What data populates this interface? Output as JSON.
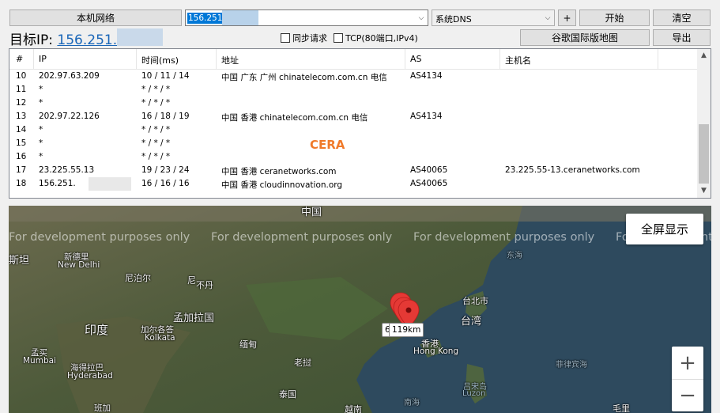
{
  "toolbar": {
    "local_network_label": "本机网络",
    "target_input_value": "156.251.",
    "dns_select_value": "系统DNS",
    "add_label": "+",
    "start_label": "开始",
    "clear_label": "清空",
    "google_map_label": "谷歌国际版地图",
    "export_label": "导出"
  },
  "target": {
    "label": "目标IP:",
    "ip": "156.251."
  },
  "options": {
    "sync_request": "同步请求",
    "tcp_option": "TCP(80端口,IPv4)"
  },
  "table": {
    "columns": [
      "#",
      "IP",
      "时间(ms)",
      "地址",
      "AS",
      "主机名"
    ],
    "rows": [
      {
        "hop": "10",
        "ip": "202.97.63.209",
        "time": "10 / 11 / 14",
        "addr": "中国 广东 广州 chinatelecom.com.cn 电信",
        "as": "AS4134",
        "host": ""
      },
      {
        "hop": "11",
        "ip": "*",
        "time": "* / * / *",
        "addr": "",
        "as": "",
        "host": ""
      },
      {
        "hop": "12",
        "ip": "*",
        "time": "* / * / *",
        "addr": "",
        "as": "",
        "host": ""
      },
      {
        "hop": "13",
        "ip": "202.97.22.126",
        "time": "16 / 18 / 19",
        "addr": "中国 香港 chinatelecom.com.cn 电信",
        "as": "AS4134",
        "host": ""
      },
      {
        "hop": "14",
        "ip": "*",
        "time": "* / * / *",
        "addr": "",
        "as": "",
        "host": ""
      },
      {
        "hop": "15",
        "ip": "*",
        "time": "* / * / *",
        "addr": "",
        "as": "",
        "host": ""
      },
      {
        "hop": "16",
        "ip": "*",
        "time": "* / * / *",
        "addr": "",
        "as": "",
        "host": ""
      },
      {
        "hop": "17",
        "ip": "23.225.55.13",
        "time": "19 / 23 / 24",
        "addr": "中国 香港 ceranetworks.com",
        "as": "AS40065",
        "host": "23.225.55-13.ceranetworks.com"
      },
      {
        "hop": "18",
        "ip": "156.251.",
        "time": "16 / 16 / 16",
        "addr": "中国 香港 cloudinnovation.org",
        "as": "AS40065",
        "host": ""
      }
    ],
    "overlay_label": "CERA"
  },
  "map": {
    "watermark": "For development purposes only",
    "fullscreen_label": "全屏显示",
    "zoom_in": "+",
    "zoom_out": "−",
    "distance_label": "119km",
    "labels": {
      "china": "中国",
      "delhi_cn": "新德里",
      "delhi_en": "New Delhi",
      "india": "印度",
      "nepal": "尼泊尔",
      "bangladesh": "孟加拉国",
      "kolkata_cn": "加尔各答",
      "kolkata_en": "Kolkata",
      "myanmar": "缅甸",
      "laos": "老挝",
      "thailand": "泰国",
      "vietnam": "越南",
      "taipei": "台北市",
      "taiwan": "台湾",
      "hongkong_cn": "香港",
      "hongkong_en": "Hong Kong",
      "mumbai_cn": "孟买",
      "mumbai_en": "Mumbai",
      "hyderabad_cn": "海得拉巴",
      "hyderabad_en": "Hyderabad",
      "pakistan_short": "斯坦",
      "east_sea": "东海",
      "philippine_sea": "菲律宾海",
      "luzon_cn": "吕宋岛",
      "luzon_en": "Luzon",
      "south_sea": "南海",
      "bhutan": "不丹",
      "bengaluru": "班加",
      "mao": "毛里",
      "ni": "尼"
    }
  },
  "colors": {
    "accent_blue": "#1a66b8",
    "cera_orange": "#f07a2a",
    "marker_red": "#e53935"
  }
}
